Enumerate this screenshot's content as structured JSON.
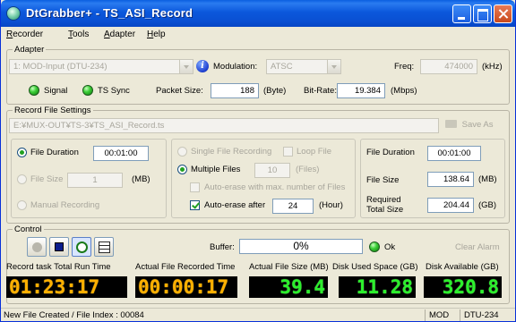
{
  "window": {
    "title": "DtGrabber+ - TS_ASI_Record"
  },
  "menu": [
    "Recorder",
    "Tools",
    "Adapter",
    "Help"
  ],
  "adapter": {
    "group_label": "Adapter",
    "device": "1: MOD-Input (DTU-234)",
    "modulation_label": "Modulation:",
    "modulation_value": "ATSC",
    "freq_label": "Freq:",
    "freq_value": "474000",
    "freq_unit": "(kHz)",
    "signal_label": "Signal",
    "ts_sync_label": "TS Sync",
    "packet_size_label": "Packet Size:",
    "packet_size_value": "188",
    "packet_size_unit": "(Byte)",
    "bitrate_label": "Bit-Rate:",
    "bitrate_value": "19.384",
    "bitrate_unit": "(Mbps)"
  },
  "record_file": {
    "group_label": "Record File Settings",
    "path": "E:¥MUX-OUT¥TS-3¥TS_ASI_Record.ts",
    "save_as_label": "Save As",
    "file_duration_label": "File Duration",
    "file_duration_value": "00:01:00",
    "file_size_label": "File Size",
    "file_size_value": "1",
    "file_size_unit": "(MB)",
    "manual_recording_label": "Manual Recording",
    "single_file_label": "Single File Recording",
    "loop_file_label": "Loop File",
    "multiple_files_label": "Multiple Files",
    "files_value": "10",
    "files_unit": "(Files)",
    "auto_erase_max_label": "Auto-erase with max. number of Files",
    "auto_erase_after_label": "Auto-erase after",
    "auto_erase_after_value": "24",
    "auto_erase_after_unit": "(Hour)",
    "summary_duration_label": "File Duration",
    "summary_duration_value": "00:01:00",
    "summary_size_label": "File Size",
    "summary_size_value": "138.64",
    "summary_size_unit": "(MB)",
    "required_total_label_1": "Required",
    "required_total_label_2": "Total Size",
    "required_total_value": "204.44",
    "required_total_unit": "(GB)"
  },
  "control": {
    "group_label": "Control",
    "buffer_label": "Buffer:",
    "buffer_value": "0%",
    "buffer_fraction": 0,
    "ok_label": "Ok",
    "clear_alarm_label": "Clear Alarm",
    "total_run_time_label": "Record task Total Run Time",
    "total_run_time_value": "01:23:17",
    "file_recorded_time_label": "Actual File Recorded Time",
    "file_recorded_time_value": "00:00:17",
    "actual_file_size_label": "Actual File Size  (MB)",
    "actual_file_size_value": "39.4",
    "disk_used_label": "Disk Used Space (GB)",
    "disk_used_value": "11.28",
    "disk_available_label": "Disk Available  (GB)",
    "disk_available_value": "320.8"
  },
  "status": {
    "message": "New File Created / File Index : 00084",
    "mode": "MOD",
    "device": "DTU-234"
  },
  "colors": {
    "accent": "#0a4fd2",
    "led_green": "#3fd03a",
    "seg_orange": "#ffb000",
    "seg_green": "#2cf02c"
  }
}
